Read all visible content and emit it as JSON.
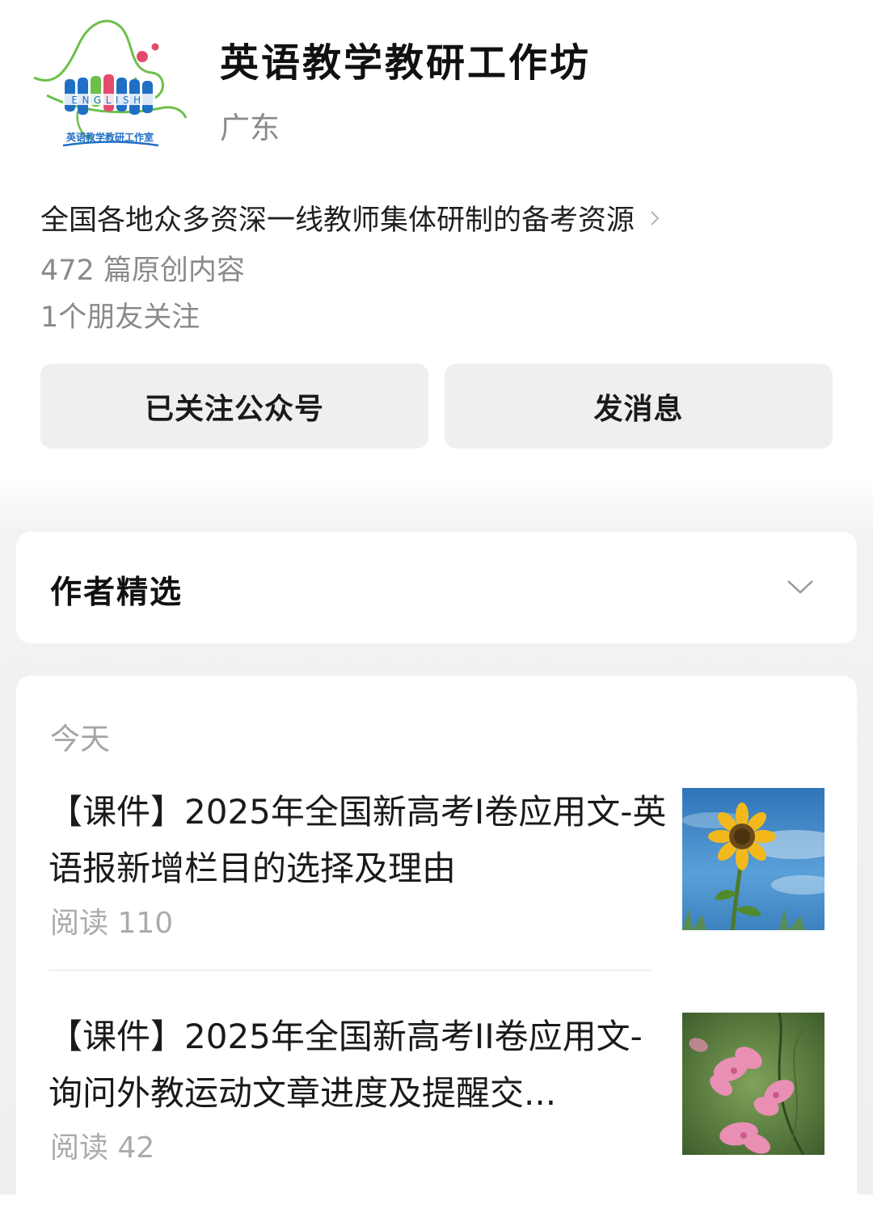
{
  "profile": {
    "logo_text": "ENGLISH",
    "logo_caption": "英语教学教研工作室",
    "name": "英语教学教研工作坊",
    "region": "广东",
    "description": "全国各地众多资深一线教师集体研制的备考资源",
    "articles_count": "472 篇原创内容",
    "friends_following": "1个朋友关注"
  },
  "actions": {
    "follow_label": "已关注公众号",
    "message_label": "发消息"
  },
  "author_picks": {
    "title": "作者精选"
  },
  "feed": {
    "date_label": "今天",
    "articles": [
      {
        "title": "【课件】2025年全国新高考I卷应用文-英语报新增栏目的选择及理由",
        "reads": "阅读 110",
        "thumbnail": "sunflower-photo"
      },
      {
        "title": "【课件】2025年全国新高考II卷应用文-询问外教运动文章进度及提醒交...",
        "reads": "阅读 42",
        "thumbnail": "pink-flowers-photo"
      }
    ]
  },
  "colors": {
    "logo_green": "#6cc04a",
    "logo_blue": "#1f6fc4",
    "logo_pink": "#e34b6d",
    "muted_text": "#8a8a8a",
    "button_bg": "#efefef"
  }
}
